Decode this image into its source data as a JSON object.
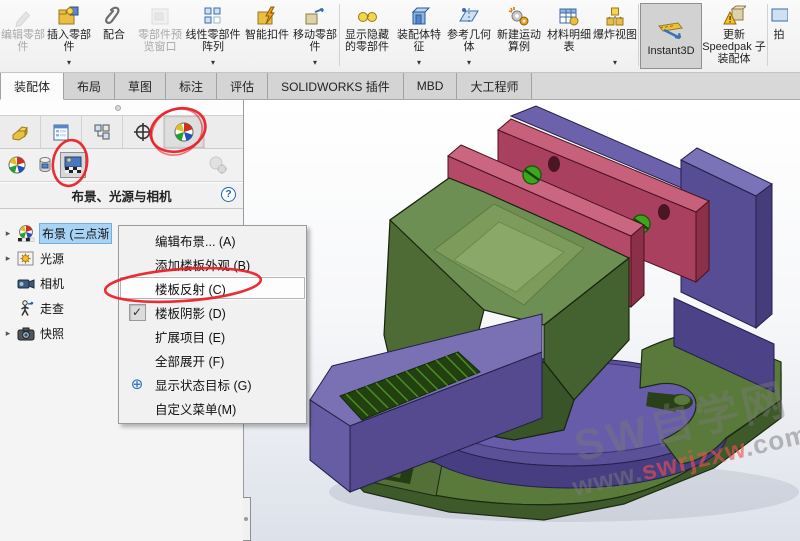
{
  "icons": {
    "caret_down": "▾",
    "expand_arrow": "▸",
    "check": "✓",
    "help": "?",
    "menu_target": "⊕"
  },
  "toolbar": {
    "items": [
      {
        "label": "编辑零部件",
        "disabled": true
      },
      {
        "label": "插入零部件",
        "dropdown": true
      },
      {
        "label": "配合"
      },
      {
        "label": "零部件预览窗口",
        "disabled": true
      },
      {
        "label": "线性零部件阵列",
        "dropdown": true
      },
      {
        "label": "智能扣件"
      },
      {
        "label": "移动零部件",
        "dropdown": true
      },
      {
        "label": "显示隐藏的零部件"
      },
      {
        "label": "装配体特征",
        "dropdown": true
      },
      {
        "label": "参考几何体",
        "dropdown": true
      },
      {
        "label": "新建运动算例"
      },
      {
        "label": "材料明细表"
      },
      {
        "label": "爆炸视图",
        "dropdown": true
      },
      {
        "label": "Instant3D",
        "pressed": true
      },
      {
        "label": "更新 Speedpak 子装配体"
      },
      {
        "label": "拍"
      }
    ]
  },
  "ribbon_tabs": {
    "active": "装配体",
    "items": [
      {
        "label": "装配体"
      },
      {
        "label": "布局"
      },
      {
        "label": "草图"
      },
      {
        "label": "标注"
      },
      {
        "label": "评估"
      },
      {
        "label": "SOLIDWORKS 插件"
      },
      {
        "label": "MBD"
      },
      {
        "label": "大工程师"
      }
    ]
  },
  "panel": {
    "title": "布景、光源与相机",
    "tabs": [
      {
        "name": "feature-manager"
      },
      {
        "name": "property-manager"
      },
      {
        "name": "configuration-manager"
      },
      {
        "name": "dimxpert-manager"
      },
      {
        "name": "display-manager",
        "annotated": true
      }
    ],
    "subtabs": [
      {
        "name": "view-appearances"
      },
      {
        "name": "view-decals"
      },
      {
        "name": "view-scene-lights-cameras",
        "pressed": true,
        "annotated": true
      },
      {
        "name": "options",
        "disabled": true
      }
    ],
    "tree": [
      {
        "label": "布景 (三点渐",
        "selected": true,
        "expandable": true
      },
      {
        "label": "光源",
        "expandable": true
      },
      {
        "label": "相机"
      },
      {
        "label": "走查"
      },
      {
        "label": "快照",
        "expandable": true
      }
    ]
  },
  "context_menu": {
    "items": [
      {
        "label": "编辑布景... (A)"
      },
      {
        "label": "添加楼板外观 (B)"
      },
      {
        "label": "楼板反射 (C)",
        "highlighted": true,
        "annotated": true
      },
      {
        "label": "楼板阴影 (D)",
        "checked": true
      },
      {
        "label": "扩展项目 (E)"
      },
      {
        "label": "全部展开 (F)"
      },
      {
        "label": "显示状态目标 (G)",
        "icon": "target"
      },
      {
        "label": "自定义菜单(M)"
      }
    ]
  },
  "watermark": {
    "line1": "SW自学网",
    "line2_prefix": "www.",
    "line2_highlight": "swrjzxw",
    "line2_suffix": ".com"
  },
  "colors": {
    "annotation_red": "#e81c24",
    "selection_blue": "#a8d3f4",
    "model_green": "#55713c",
    "model_green_light": "#7d9c5b",
    "model_green_dark": "#3a5226",
    "model_purple": "#574d95",
    "model_purple_light": "#7b73b8",
    "model_purple_dark": "#453c7c",
    "model_red": "#a93f5e",
    "model_red_light": "#c7607a",
    "model_red_dark": "#8c3049",
    "screw_green": "#3fa51c",
    "nut_magenta": "#7c2a62"
  }
}
